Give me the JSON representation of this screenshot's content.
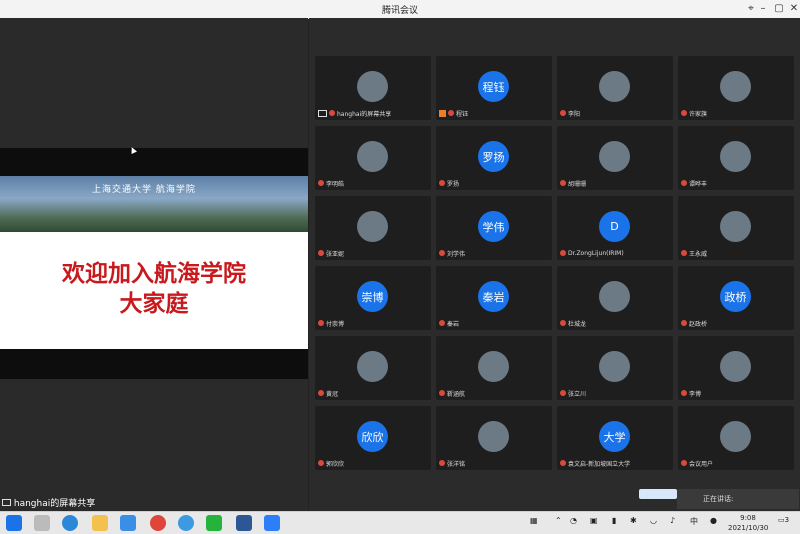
{
  "window": {
    "title": "腾讯会议"
  },
  "share": {
    "slide_banner_text": "上海交通大学 航海学院",
    "slide_line1": "欢迎加入航海学院",
    "slide_line2": "大家庭",
    "sharer_label": "hanghai的屏幕共享"
  },
  "participants": [
    {
      "name": "hanghai的屏幕共享",
      "avatar": "photo",
      "avatar_text": ""
    },
    {
      "name": "程钰",
      "avatar": "text",
      "avatar_text": "程钰"
    },
    {
      "name": "李阳",
      "avatar": "photo",
      "avatar_text": ""
    },
    {
      "name": "许家旗",
      "avatar": "photo",
      "avatar_text": ""
    },
    {
      "name": "李明皓",
      "avatar": "photo",
      "avatar_text": ""
    },
    {
      "name": "罗扬",
      "avatar": "text",
      "avatar_text": "罗扬"
    },
    {
      "name": "胡珊珊",
      "avatar": "photo",
      "avatar_text": ""
    },
    {
      "name": "谭晔丰",
      "avatar": "photo",
      "avatar_text": ""
    },
    {
      "name": "张亚妮",
      "avatar": "photo",
      "avatar_text": ""
    },
    {
      "name": "刘学伟",
      "avatar": "text",
      "avatar_text": "学伟"
    },
    {
      "name": "Dr.ZongLijun(IRIM)",
      "avatar": "text",
      "avatar_text": "D"
    },
    {
      "name": "王永威",
      "avatar": "photo",
      "avatar_text": ""
    },
    {
      "name": "付崇博",
      "avatar": "text",
      "avatar_text": "崇博"
    },
    {
      "name": "秦岩",
      "avatar": "text",
      "avatar_text": "秦岩"
    },
    {
      "name": "杜城龙",
      "avatar": "photo",
      "avatar_text": ""
    },
    {
      "name": "赵政桥",
      "avatar": "text",
      "avatar_text": "政桥"
    },
    {
      "name": "黄冠",
      "avatar": "photo",
      "avatar_text": ""
    },
    {
      "name": "靳涵航",
      "avatar": "photo",
      "avatar_text": ""
    },
    {
      "name": "张立川",
      "avatar": "photo",
      "avatar_text": ""
    },
    {
      "name": "李博",
      "avatar": "photo",
      "avatar_text": ""
    },
    {
      "name": "郭欣欣",
      "avatar": "text",
      "avatar_text": "欣欣"
    },
    {
      "name": "张洋铭",
      "avatar": "photo",
      "avatar_text": ""
    },
    {
      "name": "袁文启-新加坡国立大学",
      "avatar": "text",
      "avatar_text": "大学"
    },
    {
      "name": "会议用户",
      "avatar": "photo",
      "avatar_text": ""
    }
  ],
  "speaking": {
    "label": "正在讲话:"
  },
  "taskbar": {
    "time": "9:08",
    "date": "2021/10/30",
    "notif_count": "3"
  },
  "colors": {
    "accent_blue": "#1a73e8",
    "slide_red": "#c8191d"
  }
}
